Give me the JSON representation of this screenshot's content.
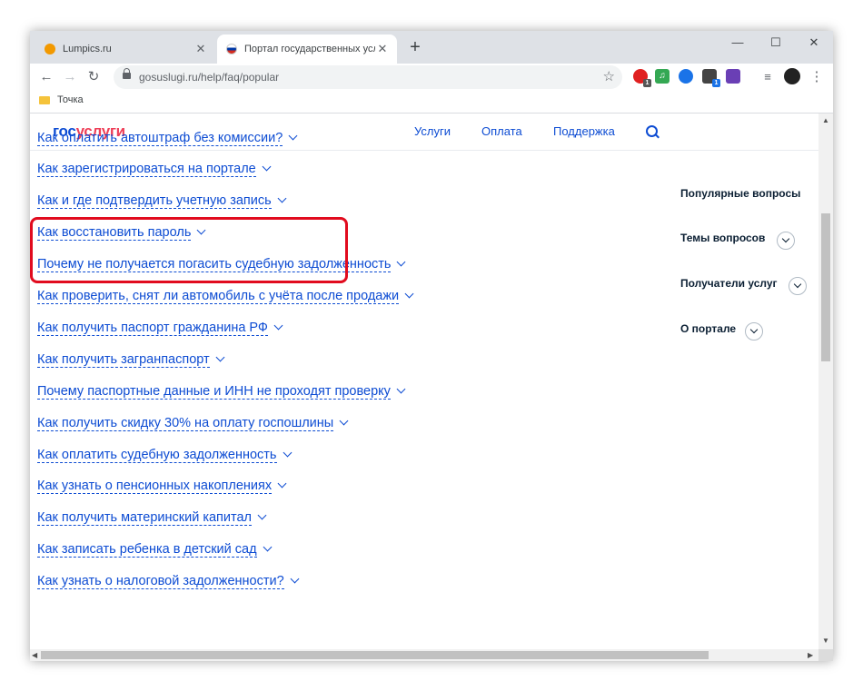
{
  "browser": {
    "tabs": [
      {
        "title": "Lumpics.ru",
        "favicon_color": "#f29900"
      },
      {
        "title": "Портал государственных услуг Р",
        "favicon_color": "#d52b1e"
      }
    ],
    "new_tab_label": "+",
    "close_glyph": "✕",
    "window_controls": {
      "minimize": "—",
      "maximize": "☐",
      "close": "✕"
    },
    "url": "gosuslugi.ru/help/faq/popular",
    "bookmarks": [
      {
        "label": "Точка"
      }
    ],
    "extensions": [
      {
        "name": "ext-red-icon",
        "color": "#e02020",
        "badge": "1"
      },
      {
        "name": "ext-green-icon",
        "color": "#34a853",
        "badge": ""
      },
      {
        "name": "ext-globe-icon",
        "color": "#1a73e8",
        "badge": ""
      },
      {
        "name": "ext-box-icon",
        "color": "#444444",
        "badge": "1"
      },
      {
        "name": "ext-purple-icon",
        "color": "#6a3fb5",
        "badge": ""
      }
    ]
  },
  "site": {
    "logo_part1": "гос",
    "logo_part2": "услуги",
    "nav": [
      {
        "label": "Услуги"
      },
      {
        "label": "Оплата"
      },
      {
        "label": "Поддержка"
      }
    ]
  },
  "faq": [
    {
      "question": "Как оплатить автоштраф без комиссии?"
    },
    {
      "question": "Как зарегистрироваться на портале"
    },
    {
      "question": "Как и где подтвердить учетную запись"
    },
    {
      "question": "Как восстановить пароль"
    },
    {
      "question": "Почему не получается погасить судебную задолженность"
    },
    {
      "question": "Как проверить, снят ли автомобиль с учёта после продажи"
    },
    {
      "question": "Как получить паспорт гражданина РФ"
    },
    {
      "question": "Как получить загранпаспорт"
    },
    {
      "question": "Почему паспортные данные и ИНН не проходят проверку"
    },
    {
      "question": "Как получить скидку 30% на оплату госпошлины"
    },
    {
      "question": "Как оплатить судебную задолженность"
    },
    {
      "question": "Как узнать о пенсионных накоплениях"
    },
    {
      "question": "Как получить материнский капитал"
    },
    {
      "question": "Как записать ребенка в детский сад"
    },
    {
      "question": "Как узнать о налоговой задолженности?"
    }
  ],
  "sidebar": [
    {
      "label": "Популярные вопросы",
      "expandable": false
    },
    {
      "label": "Темы вопросов",
      "expandable": true
    },
    {
      "label": "Получатели услуг",
      "expandable": true
    },
    {
      "label": "О портале",
      "expandable": true
    }
  ],
  "colors": {
    "link": "#0d4cd3",
    "logo_blue": "#0d4cd3",
    "logo_red": "#ee3f58",
    "highlight": "#e10b1e"
  }
}
